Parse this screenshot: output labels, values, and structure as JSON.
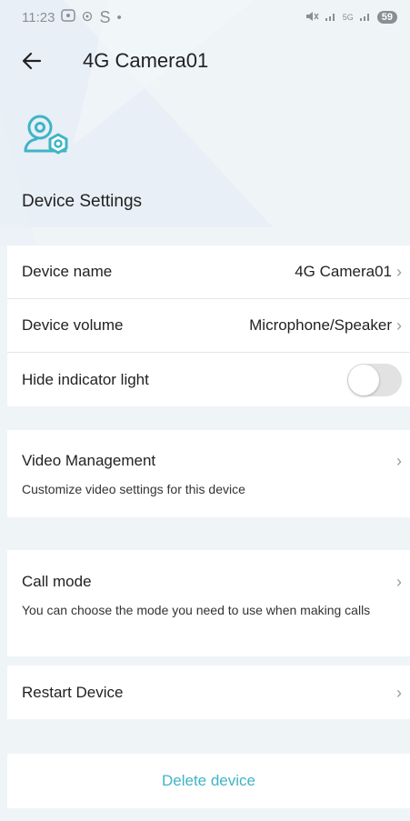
{
  "status_bar": {
    "time": "11:23",
    "left_icons": [
      "screenshot-icon",
      "nfc-icon",
      "s-icon",
      "dot-icon"
    ],
    "s_label": "S",
    "signal_labels": [
      "5G"
    ],
    "battery": "59"
  },
  "header": {
    "title": "4G Camera01"
  },
  "device_icon": "camera-settings-icon",
  "section_title": "Device Settings",
  "settings": {
    "device_name": {
      "label": "Device name",
      "value": "4G Camera01"
    },
    "device_volume": {
      "label": "Device volume",
      "value": "Microphone/Speaker"
    },
    "hide_indicator": {
      "label": "Hide indicator light",
      "enabled": false
    }
  },
  "video_management": {
    "label": "Video Management",
    "description": "Customize video settings for this device"
  },
  "call_mode": {
    "label": "Call mode",
    "description": "You can choose the mode you need to use when making calls"
  },
  "restart": {
    "label": "Restart Device"
  },
  "delete": {
    "label": "Delete device"
  },
  "colors": {
    "accent": "#3fb4c6",
    "background": "#eff4f7",
    "toggle_off": "#e2e2e2"
  }
}
